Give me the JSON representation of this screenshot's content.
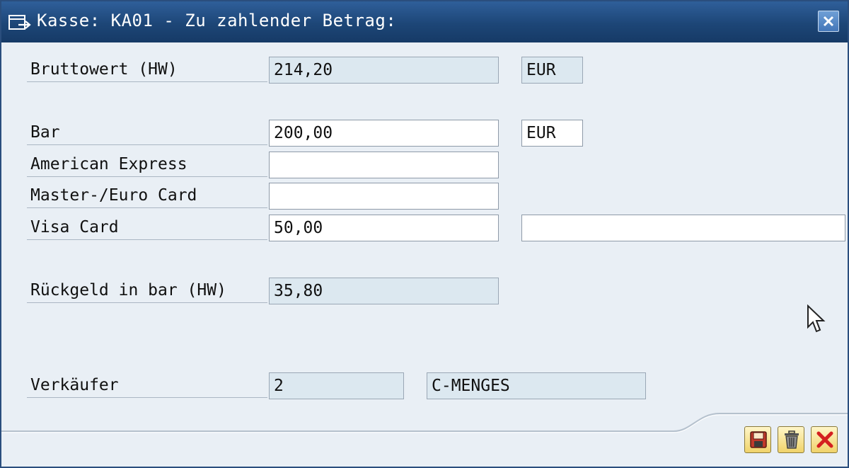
{
  "window": {
    "title": "Kasse: KA01 - Zu zahlender Betrag:"
  },
  "form": {
    "gross": {
      "label": "Bruttowert (HW)",
      "value": "214,20",
      "currency": "EUR"
    },
    "cash": {
      "label": "Bar",
      "value": "200,00",
      "currency": "EUR"
    },
    "amex": {
      "label": "American Express",
      "value": ""
    },
    "mastercard": {
      "label": "Master-/Euro Card",
      "value": ""
    },
    "visa": {
      "label": "Visa Card",
      "value": "50,00",
      "extra": ""
    },
    "change": {
      "label": "Rückgeld in bar (HW)",
      "value": "35,80"
    },
    "seller": {
      "label": "Verkäufer",
      "id": "2",
      "name": "C-MENGES"
    }
  },
  "icons": {
    "title": "dialog-edit-icon",
    "close": "close-icon",
    "save": "save-icon",
    "delete": "trash-icon",
    "cancel": "cancel-icon"
  },
  "colors": {
    "titlebar": "#1d4677",
    "background": "#e9eff5",
    "readonly_field": "#dce8f0",
    "button_yellow": "#f0d36a",
    "cancel_red": "#d42020"
  }
}
